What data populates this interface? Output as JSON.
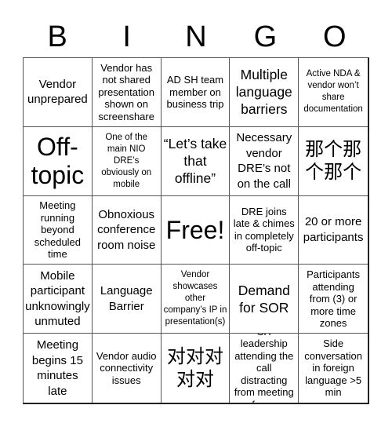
{
  "header": {
    "letters": [
      "B",
      "I",
      "N",
      "G",
      "O"
    ]
  },
  "grid": {
    "cells": [
      {
        "text": "Vendor unprepared"
      },
      {
        "text": "Vendor has not shared presentation shown on screenshare"
      },
      {
        "text": "AD SH team member on business trip"
      },
      {
        "text": "Multiple language barriers"
      },
      {
        "text": "Active NDA & vendor won’t share documentation"
      },
      {
        "text": "Off-topic"
      },
      {
        "text": "One of the main NIO DRE’s obviously on mobile"
      },
      {
        "text": "“Let’s take that offline”"
      },
      {
        "text": "Necessary vendor DRE’s not on the call"
      },
      {
        "text": "那个那个那个"
      },
      {
        "text": "Meeting running beyond scheduled time"
      },
      {
        "text": "Obnoxious conference room noise"
      },
      {
        "text": "Free!"
      },
      {
        "text": "DRE joins late & chimes in completely off-topic"
      },
      {
        "text": "20 or more participants"
      },
      {
        "text": "Mobile participant unknowingly unmuted"
      },
      {
        "text": "Language Barrier"
      },
      {
        "text": "Vendor showcases other company’s IP in presentation(s)"
      },
      {
        "text": "Demand for SOR"
      },
      {
        "text": "Participants attending from (3) or more time zones"
      },
      {
        "text": "Meeting begins 15 minutes late"
      },
      {
        "text": "Vendor audio connectivity issues"
      },
      {
        "text": "对对对对对"
      },
      {
        "text": "SH leadership attending the call distracting from meeting focus"
      },
      {
        "text": "Side conversation in foreign language >5 min"
      }
    ]
  }
}
